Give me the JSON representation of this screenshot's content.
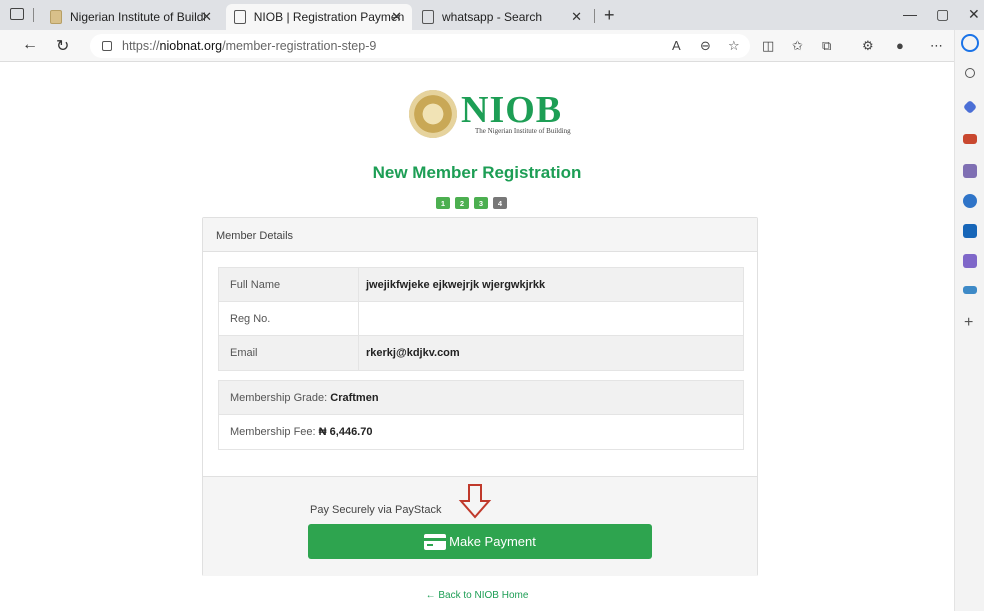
{
  "browser": {
    "tabs": [
      {
        "title": "Nigerian Institute of Building | N",
        "active": false
      },
      {
        "title": "NIOB | Registration Payment",
        "active": true
      },
      {
        "title": "whatsapp - Search",
        "active": false
      }
    ],
    "url_scheme": "https://",
    "url_host": "niobnat.org",
    "url_path": "/member-registration-step-9",
    "window_controls": [
      "—",
      "▢",
      "✕"
    ]
  },
  "page": {
    "logo_text": "NIOB",
    "logo_subtext": "The Nigerian Institute of Building",
    "heading": "New Member Registration",
    "steps": [
      "1",
      "2",
      "3",
      "4"
    ],
    "card_header": "Member Details",
    "details": [
      {
        "label": "Full Name",
        "value": "jwejikfwjeke ejkwejrjk wjergwkjrkk"
      },
      {
        "label": "Reg No.",
        "value": ""
      },
      {
        "label": "Email",
        "value": "rkerkj@kdjkv.com"
      }
    ],
    "grade_label": "Membership Grade: ",
    "grade_value": "Craftmen",
    "fee_label": "Membership Fee: ",
    "fee_value": "₦ 6,446.70",
    "pay_text": "Pay Securely via PayStack",
    "pay_button": "Make Payment",
    "back_link": "← Back to NIOB Home"
  },
  "colors": {
    "brand_green": "#1d9e55",
    "button_green": "#2ea44f",
    "arrow_red": "#c0392b"
  }
}
